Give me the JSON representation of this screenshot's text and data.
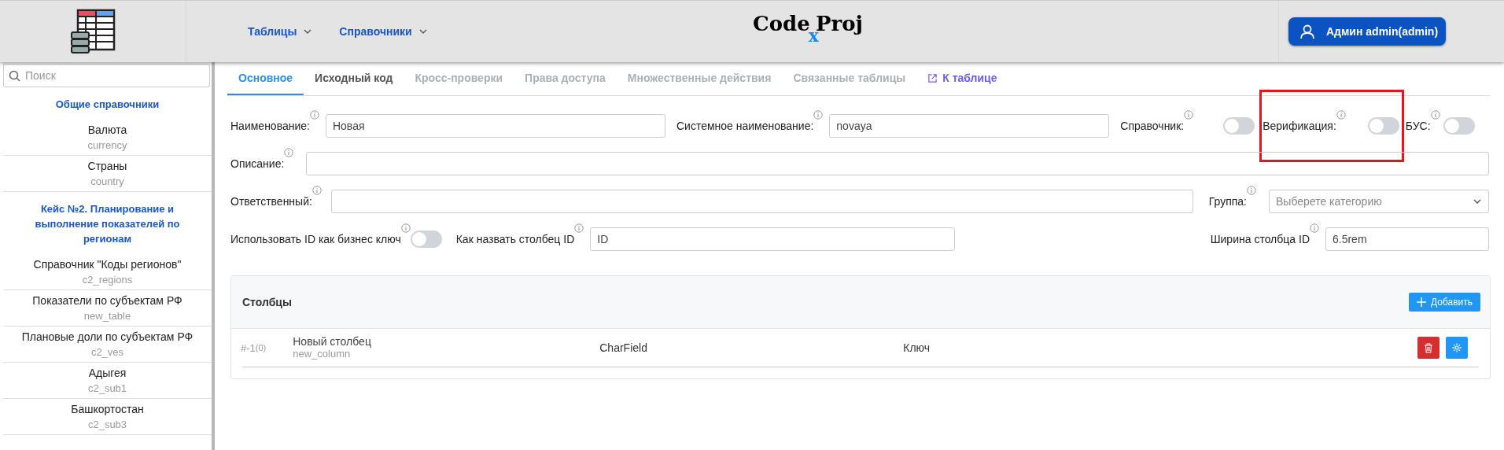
{
  "header": {
    "logo": {
      "part_1": "Code",
      "part_2": "x",
      "part_3": "Proj"
    },
    "nav": [
      {
        "label": "Таблицы"
      },
      {
        "label": "Справочники"
      }
    ],
    "user_button": "Админ admin(admin)"
  },
  "sidebar": {
    "search": {
      "placeholder": "Поиск"
    },
    "groups": [
      {
        "title": "Общие справочники",
        "items": [
          {
            "name": "Валюта",
            "code": "currency"
          },
          {
            "name": "Страны",
            "code": "country"
          }
        ]
      },
      {
        "title": "Кейс №2. Планирование и выполнение показателей по регионам",
        "items": [
          {
            "name": "Справочник \"Коды регионов\"",
            "code": "c2_regions"
          },
          {
            "name": "Показатели по субъектам РФ",
            "code": "new_table"
          },
          {
            "name": "Плановые доли по субъектам РФ",
            "code": "c2_ves"
          },
          {
            "name": "Адыгея",
            "code": "c2_sub1"
          },
          {
            "name": "Башкортостан",
            "code": "c2_sub3"
          }
        ]
      }
    ]
  },
  "tabs": [
    {
      "label": "Основное",
      "selected": true,
      "kind": "tab",
      "disabled": false
    },
    {
      "label": "Исходный код",
      "selected": false,
      "kind": "tab",
      "disabled": false
    },
    {
      "label": "Кросс-проверки",
      "selected": false,
      "kind": "tab",
      "disabled": true
    },
    {
      "label": "Права доступа",
      "selected": false,
      "kind": "tab",
      "disabled": true
    },
    {
      "label": "Множественные действия",
      "selected": false,
      "kind": "tab",
      "disabled": true
    },
    {
      "label": "Связанные таблицы",
      "selected": false,
      "kind": "tab",
      "disabled": true
    }
  ],
  "table_link": "К таблице",
  "form": {
    "fields": [
      {
        "kind": "text",
        "label": "Наименование:",
        "value": "Новая"
      },
      {
        "kind": "text",
        "label": "Системное наименование:",
        "value": "novaya"
      },
      {
        "kind": "toggle",
        "label": "Справочник:",
        "on": false,
        "highlighted": false
      },
      {
        "kind": "toggle",
        "label": "Верификация:",
        "on": false,
        "highlighted": true
      },
      {
        "kind": "toggle",
        "label": "БУС:",
        "on": false,
        "highlighted": false
      },
      {
        "kind": "text",
        "label": "Описание:"
      },
      {
        "kind": "text",
        "label": "Ответственный:"
      },
      {
        "kind": "select",
        "label": "Группа:",
        "placeholder": "Выберете категорию"
      },
      {
        "kind": "toggle",
        "label": "Использовать ID как бизнес ключ",
        "on": false,
        "highlighted": false
      },
      {
        "kind": "text",
        "label": "Как назвать столбец ID",
        "value": "ID"
      },
      {
        "kind": "text",
        "label": "Ширина столбца ID",
        "value": "6.5rem"
      }
    ]
  },
  "columns_panel": {
    "title": "Столбцы",
    "add_button": "Добавить",
    "rows": [
      {
        "number": "#-1",
        "count": "(0)",
        "name": "Новый столбец",
        "code": "new_column",
        "type": "CharField",
        "column_4": "Ключ"
      }
    ]
  }
}
